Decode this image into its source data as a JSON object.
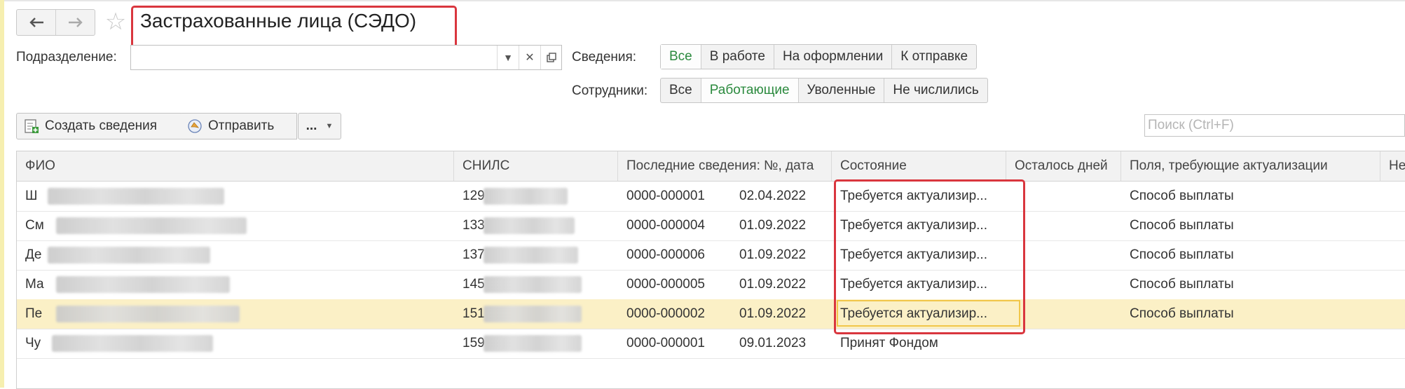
{
  "header": {
    "back_icon": "arrow-left-icon",
    "forward_icon": "arrow-right-icon",
    "favorite_icon": "star-icon",
    "title": "Застрахованные лица (СЭДО)"
  },
  "filters": {
    "division_label": "Подразделение:",
    "division_value": "",
    "info_label": "Сведения:",
    "info_options": [
      "Все",
      "В работе",
      "На оформлении",
      "К отправке"
    ],
    "info_active": "Все",
    "employees_label": "Сотрудники:",
    "employees_options": [
      "Все",
      "Работающие",
      "Уволенные",
      "Не числились"
    ],
    "employees_active": "Работающие"
  },
  "toolbar": {
    "create_label": "Создать сведения",
    "send_label": "Отправить",
    "more_label": "...",
    "search_placeholder": "Поиск (Ctrl+F)"
  },
  "table": {
    "columns": [
      "ФИО",
      "СНИЛС",
      "Последние сведения: №, дата",
      "Состояние",
      "Осталось дней",
      "Поля, требующие актуализации",
      "Не"
    ],
    "rows": [
      {
        "fio": "Ш",
        "snils": "129",
        "num": "0000-000001",
        "date": "02.04.2022",
        "state": "Требуется актуализир...",
        "days": "",
        "fields": "Способ выплаты"
      },
      {
        "fio": "См",
        "snils": "133",
        "num": "0000-000004",
        "date": "01.09.2022",
        "state": "Требуется актуализир...",
        "days": "",
        "fields": "Способ выплаты"
      },
      {
        "fio": "Де",
        "snils": "137",
        "num": "0000-000006",
        "date": "01.09.2022",
        "state": "Требуется актуализир...",
        "days": "",
        "fields": "Способ выплаты"
      },
      {
        "fio": "Ма",
        "snils": "145",
        "num": "0000-000005",
        "date": "01.09.2022",
        "state": "Требуется актуализир...",
        "days": "",
        "fields": "Способ выплаты"
      },
      {
        "fio": "Пе",
        "snils": "151",
        "num": "0000-000002",
        "date": "01.09.2022",
        "state": "Требуется актуализир...",
        "days": "",
        "fields": "Способ выплаты"
      },
      {
        "fio": "Чу",
        "snils": "159",
        "num": "0000-000001",
        "date": "09.01.2023",
        "state": "Принят Фондом",
        "days": "",
        "fields": ""
      }
    ]
  },
  "colors": {
    "active_text": "#2b8a3e",
    "selected_row": "#fbf0c6",
    "annotation_frame": "#d9363e",
    "focus_cell": "#f1c64a"
  }
}
